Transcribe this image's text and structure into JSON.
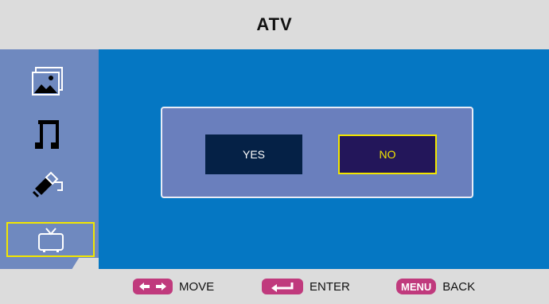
{
  "header": {
    "title": "ATV"
  },
  "sidebar": {
    "items": [
      {
        "name": "picture",
        "icon": "picture-icon",
        "selected": false
      },
      {
        "name": "sound",
        "icon": "music-note-icon",
        "selected": false
      },
      {
        "name": "setup",
        "icon": "pen-icon",
        "selected": false
      },
      {
        "name": "tv",
        "icon": "tv-icon",
        "selected": true
      }
    ]
  },
  "dialog": {
    "yes_label": "YES",
    "no_label": "NO",
    "focused": "NO"
  },
  "footer": {
    "move_label": "MOVE",
    "enter_label": "ENTER",
    "menu_key": "MENU",
    "back_label": "BACK"
  },
  "colors": {
    "header_bg": "#dcdcdc",
    "sidebar_bg": "#6f89bf",
    "main_bg": "#0577c3",
    "dialog_bg": "#6a7fbd",
    "yes_bg": "#052146",
    "no_bg": "#23165a",
    "focus": "#f3e600",
    "key_pink": "#c03a7d"
  }
}
